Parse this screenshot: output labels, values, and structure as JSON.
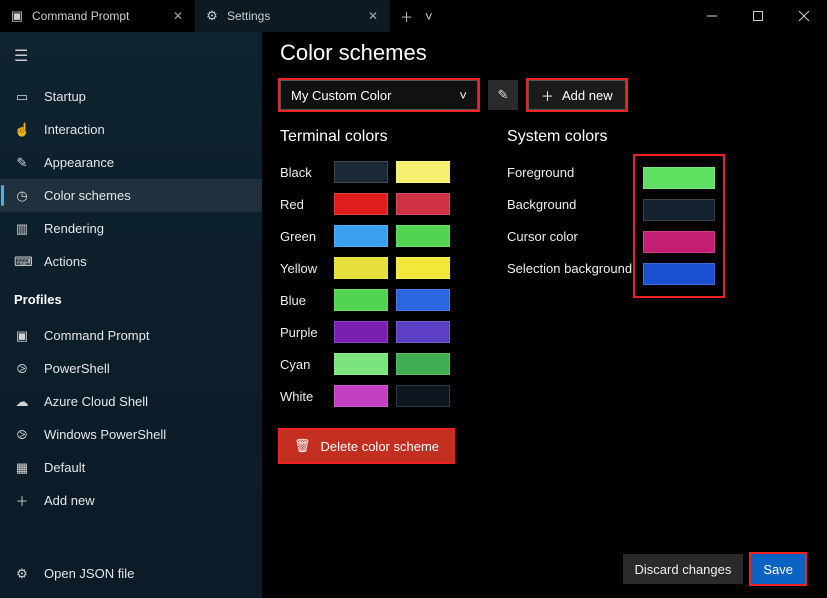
{
  "tabs": {
    "cmd_title": "Command Prompt",
    "settings_title": "Settings"
  },
  "sidebar": {
    "items": [
      {
        "icon": "▭",
        "label": "Startup"
      },
      {
        "icon": "☝",
        "label": "Interaction"
      },
      {
        "icon": "✎",
        "label": "Appearance"
      },
      {
        "icon": "◷",
        "label": "Color schemes"
      },
      {
        "icon": "▥",
        "label": "Rendering"
      },
      {
        "icon": "⌨",
        "label": "Actions"
      }
    ],
    "profiles_label": "Profiles",
    "profiles": [
      {
        "icon": "▣",
        "label": "Command Prompt"
      },
      {
        "icon": "⧁",
        "label": "PowerShell"
      },
      {
        "icon": "☁",
        "label": "Azure Cloud Shell"
      },
      {
        "icon": "⧁",
        "label": "Windows PowerShell"
      },
      {
        "icon": "▦",
        "label": "Default"
      },
      {
        "icon": "＋",
        "label": "Add new"
      }
    ],
    "open_json": {
      "icon": "⚙",
      "label": "Open JSON file"
    }
  },
  "page": {
    "title": "Color schemes",
    "scheme_selected": "My Custom Color",
    "add_new_label": "Add new",
    "terminal_heading": "Terminal colors",
    "system_heading": "System colors",
    "terminal_colors": [
      {
        "name": "Black",
        "c1": "#1c2a38",
        "c2": "#f7ed6f"
      },
      {
        "name": "Red",
        "c1": "#e01c1c",
        "c2": "#cf3045"
      },
      {
        "name": "Green",
        "c1": "#3aa2f1",
        "c2": "#52d453"
      },
      {
        "name": "Yellow",
        "c1": "#e6e13a",
        "c2": "#f2e83a"
      },
      {
        "name": "Blue",
        "c1": "#52d453",
        "c2": "#2a66e0"
      },
      {
        "name": "Purple",
        "c1": "#7a1fb0",
        "c2": "#5c3fc4"
      },
      {
        "name": "Cyan",
        "c1": "#7be37b",
        "c2": "#3fae52"
      },
      {
        "name": "White",
        "c1": "#c23fc2",
        "c2": "#0e1620"
      }
    ],
    "system_colors": [
      {
        "name": "Foreground",
        "c": "#5fe060"
      },
      {
        "name": "Background",
        "c": "#14212e"
      },
      {
        "name": "Cursor color",
        "c": "#c21f73"
      },
      {
        "name": "Selection background",
        "c": "#1a4fd1"
      }
    ],
    "delete_label": "Delete color scheme",
    "discard_label": "Discard changes",
    "save_label": "Save"
  }
}
